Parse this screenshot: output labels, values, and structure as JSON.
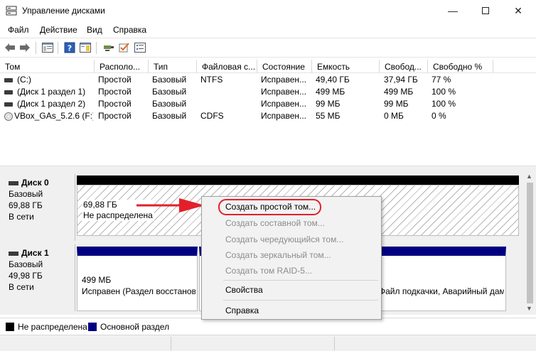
{
  "window": {
    "title": "Управление дисками"
  },
  "menu": [
    "Файл",
    "Действие",
    "Вид",
    "Справка"
  ],
  "columns": [
    "Том",
    "Располо...",
    "Тип",
    "Файловая с...",
    "Состояние",
    "Емкость",
    "Свобод...",
    "Свободно %"
  ],
  "volumes": [
    {
      "name": "(C:)",
      "layout": "Простой",
      "type": "Базовый",
      "fs": "NTFS",
      "status": "Исправен...",
      "capacity": "49,40 ГБ",
      "free": "37,94 ГБ",
      "free_pct": "77 %",
      "icon": "drive-icon"
    },
    {
      "name": "(Диск 1 раздел 1)",
      "layout": "Простой",
      "type": "Базовый",
      "fs": "",
      "status": "Исправен...",
      "capacity": "499 МБ",
      "free": "499 МБ",
      "free_pct": "100 %",
      "icon": "drive-icon"
    },
    {
      "name": "(Диск 1 раздел 2)",
      "layout": "Простой",
      "type": "Базовый",
      "fs": "",
      "status": "Исправен...",
      "capacity": "99 МБ",
      "free": "99 МБ",
      "free_pct": "100 %",
      "icon": "drive-icon"
    },
    {
      "name": "VBox_GAs_5.2.6 (F:)",
      "layout": "Простой",
      "type": "Базовый",
      "fs": "CDFS",
      "status": "Исправен...",
      "capacity": "55 МБ",
      "free": "0 МБ",
      "free_pct": "0 %",
      "icon": "cd-icon"
    }
  ],
  "disks": [
    {
      "name": "Диск 0",
      "type": "Базовый",
      "size": "69,88 ГБ",
      "state": "В сети",
      "partition": {
        "size": "69,88 ГБ",
        "label": "Не распределена"
      }
    },
    {
      "name": "Диск 1",
      "type": "Базовый",
      "size": "49,98 ГБ",
      "state": "В сети",
      "partition1": {
        "size": "499 МБ",
        "label": "Исправен (Раздел восстанов"
      },
      "partition3": {
        "label": "Файл подкачки, Аварийный дам"
      }
    }
  ],
  "legend": [
    {
      "label": "Не распределена",
      "color": "#000000"
    },
    {
      "label": "Основной раздел",
      "color": "#000080"
    }
  ],
  "context_menu": {
    "items": [
      {
        "label": "Создать простой том...",
        "enabled": true,
        "highlighted": true
      },
      {
        "label": "Создать составной том...",
        "enabled": false
      },
      {
        "label": "Создать чередующийся том...",
        "enabled": false
      },
      {
        "label": "Создать зеркальный том...",
        "enabled": false
      },
      {
        "label": "Создать том RAID-5...",
        "enabled": false
      },
      {
        "label": "Свойства",
        "enabled": true
      },
      {
        "label": "Справка",
        "enabled": true
      }
    ]
  },
  "colors": {
    "annotation": "#e3202a",
    "primary_partition": "#000080",
    "unallocated": "#000000"
  }
}
